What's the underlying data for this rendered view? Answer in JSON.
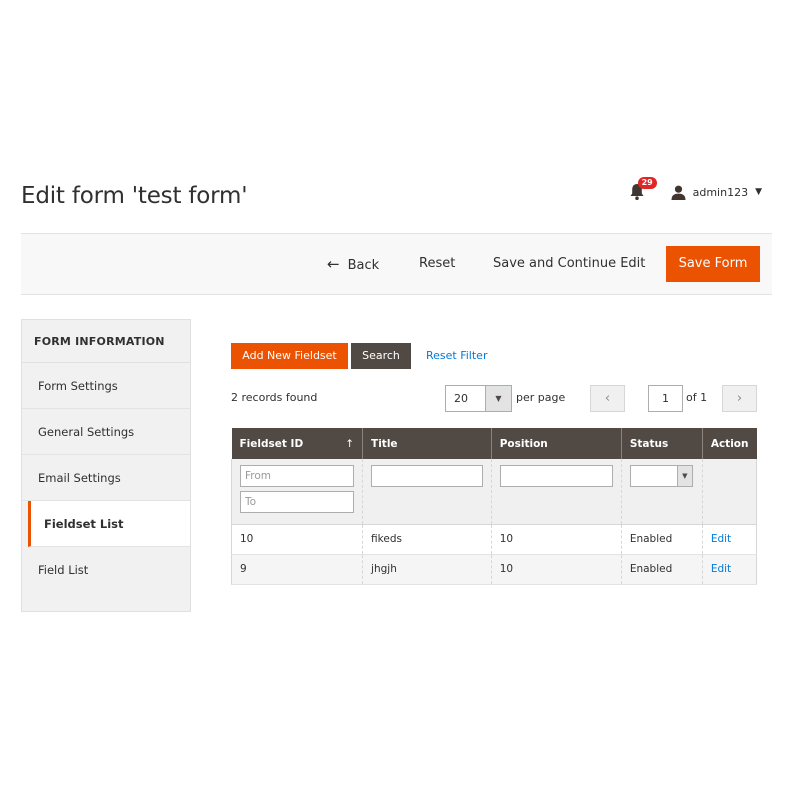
{
  "page": {
    "title": "Edit form 'test form'"
  },
  "header": {
    "notifications_count": "29",
    "user_name": "admin123"
  },
  "actions": {
    "back_label": "Back",
    "reset_label": "Reset",
    "save_continue_label": "Save and Continue Edit",
    "save_form_label": "Save Form"
  },
  "sidebar": {
    "heading": "FORM INFORMATION",
    "items": [
      {
        "label": "Form Settings"
      },
      {
        "label": "General Settings"
      },
      {
        "label": "Email Settings"
      },
      {
        "label": "Fieldset List"
      },
      {
        "label": "Field List"
      }
    ],
    "active_item": "Fieldset List"
  },
  "grid": {
    "add_label": "Add New Fieldset",
    "search_label": "Search",
    "reset_filter_label": "Reset Filter",
    "records_text": "2 records found",
    "per_page_value": "20",
    "per_page_label": "per page",
    "current_page": "1",
    "of_pages": "of 1",
    "columns": [
      "Fieldset ID",
      "Title",
      "Position",
      "Status",
      "Action"
    ],
    "filters": {
      "from_placeholder": "From",
      "to_placeholder": "To"
    },
    "rows": [
      {
        "id": "10",
        "title": "fikeds",
        "position": "10",
        "status": "Enabled",
        "action": "Edit"
      },
      {
        "id": "9",
        "title": "jhgjh",
        "position": "10",
        "status": "Enabled",
        "action": "Edit"
      }
    ]
  },
  "colors": {
    "accent": "#eb5202",
    "dark_button": "#514943",
    "link": "#007bdb",
    "badge": "#e22626"
  },
  "icons": {
    "back": "arrow-left-icon",
    "notifications": "bell-icon",
    "user": "user-icon",
    "sort": "sort-arrow-up-icon"
  }
}
